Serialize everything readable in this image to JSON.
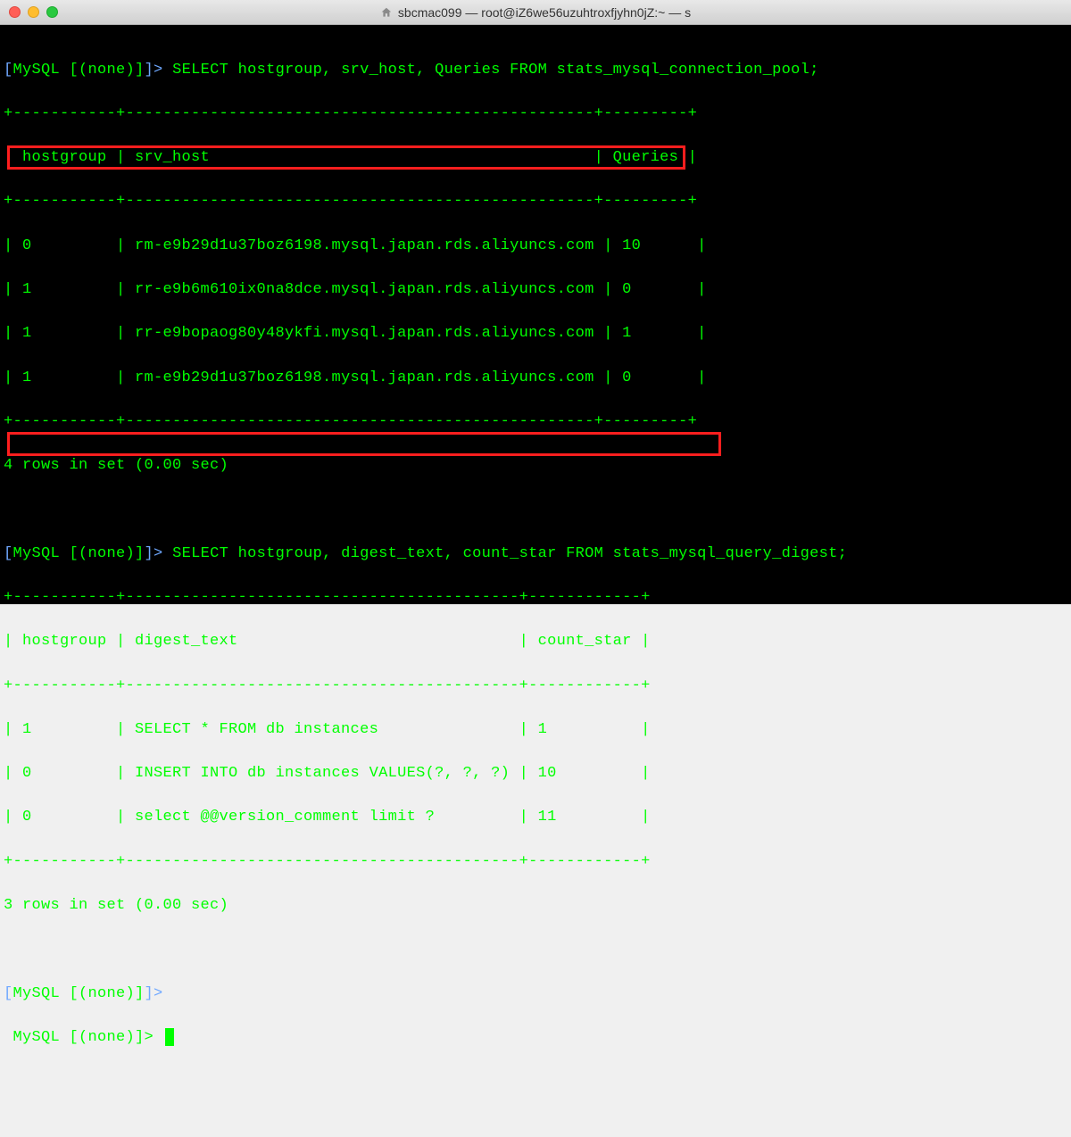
{
  "titlebar": {
    "title": "sbcmac099 — root@iZ6we56uzuhtroxfjyhn0jZ:~ — s"
  },
  "prompt_bracket_open": "[",
  "prompt_db": "MySQL [(none)]",
  "prompt_bracket_close": "]> ",
  "query1": "SELECT hostgroup, srv_host, Queries FROM stats_mysql_connection_pool;",
  "table1": {
    "sep_top": "+-----------+--------------------------------------------------+---------+",
    "header": "| hostgroup | srv_host                                         | Queries |",
    "sep_mid": "+-----------+--------------------------------------------------+---------+",
    "rows": [
      "| 0         | rm-e9b29d1u37boz6198.mysql.japan.rds.aliyuncs.com | 10      |",
      "| 1         | rr-e9b6m610ix0na8dce.mysql.japan.rds.aliyuncs.com | 0       |",
      "| 1         | rr-e9bopaog80y48ykfi.mysql.japan.rds.aliyuncs.com | 1       |",
      "| 1         | rm-e9b29d1u37boz6198.mysql.japan.rds.aliyuncs.com | 0       |"
    ],
    "sep_bot": "+-----------+--------------------------------------------------+---------+",
    "footer": "4 rows in set (0.00 sec)"
  },
  "query2": "SELECT hostgroup, digest_text, count_star FROM stats_mysql_query_digest;",
  "table2": {
    "sep_top": "+-----------+------------------------------------------+------------+",
    "header": "| hostgroup | digest_text                              | count_star |",
    "sep_mid": "+-----------+------------------------------------------+------------+",
    "rows": [
      "| 1         | SELECT * FROM db instances               | 1          |",
      "| 0         | INSERT INTO db instances VALUES(?, ?, ?) | 10         |",
      "| 0         | select @@version_comment limit ?         | 11         |"
    ],
    "sep_bot": "+-----------+------------------------------------------+------------+",
    "footer": "3 rows in set (0.00 sec)"
  },
  "empty_prompt1": "",
  "empty_prompt2": ""
}
